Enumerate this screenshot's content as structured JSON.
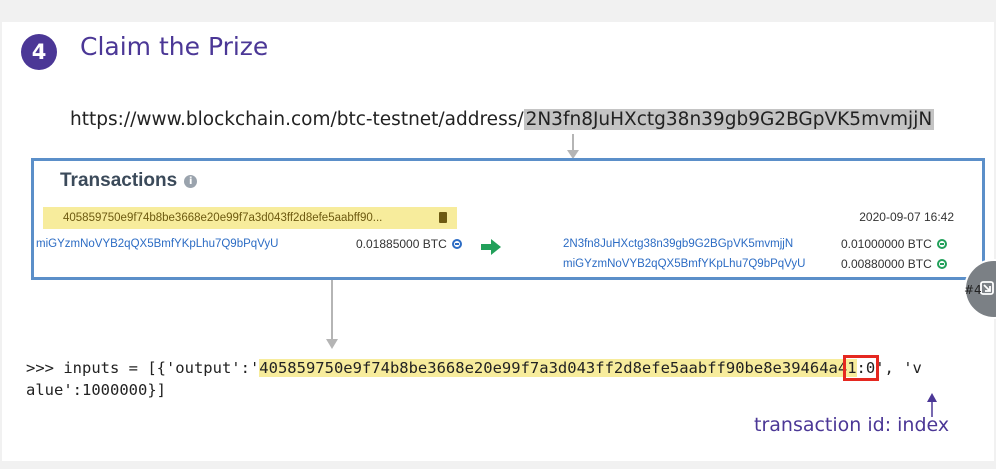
{
  "step": {
    "number": "4",
    "title": "Claim the Prize"
  },
  "url": {
    "prefix": "https://www.blockchain.com/btc-testnet/address/",
    "address": "2N3fn8JuHXctg38n39gb9G2BGpVK5mvmjjN"
  },
  "transactions": {
    "heading": "Transactions",
    "info_icon": "i",
    "hash": "405859750e9f74b8be3668e20e99f7a3d043ff2d8efe5aabff90...",
    "date": "2020-09-07 16:42",
    "input": {
      "address": "miGYzmNoVYB2qQX5BmfYKpLhu7Q9bPqVyU",
      "amount": "0.01885000 BTC"
    },
    "outputs": [
      {
        "address": "2N3fn8JuHXctg38n39gb9G2BGpVK5mvmjjN",
        "amount": "0.01000000 BTC"
      },
      {
        "address": "miGYzmNoVYB2qQX5BmfYKpLhu7Q9bPqVyU",
        "amount": "0.00880000 BTC"
      }
    ]
  },
  "code": {
    "prefix": ">>> inputs = [{'output':'",
    "txid": "405859750e9f74b8be3668e20e99f7a3d043ff2d8efe5aabff90be8e39464a4",
    "txid_last": "1",
    "index": ":0",
    "suffix_line1": "', 'v",
    "line2": "alue':1000000}]"
  },
  "annotation": "transaction id: index",
  "float_label": "#4",
  "colors": {
    "accent_purple": "#4b3796",
    "highlight_yellow": "#f7ec9c",
    "highlight_gray": "#c4c4c4",
    "box_border": "#5b8fc9",
    "index_box": "#e52820",
    "arrow_green": "#22a05a"
  }
}
